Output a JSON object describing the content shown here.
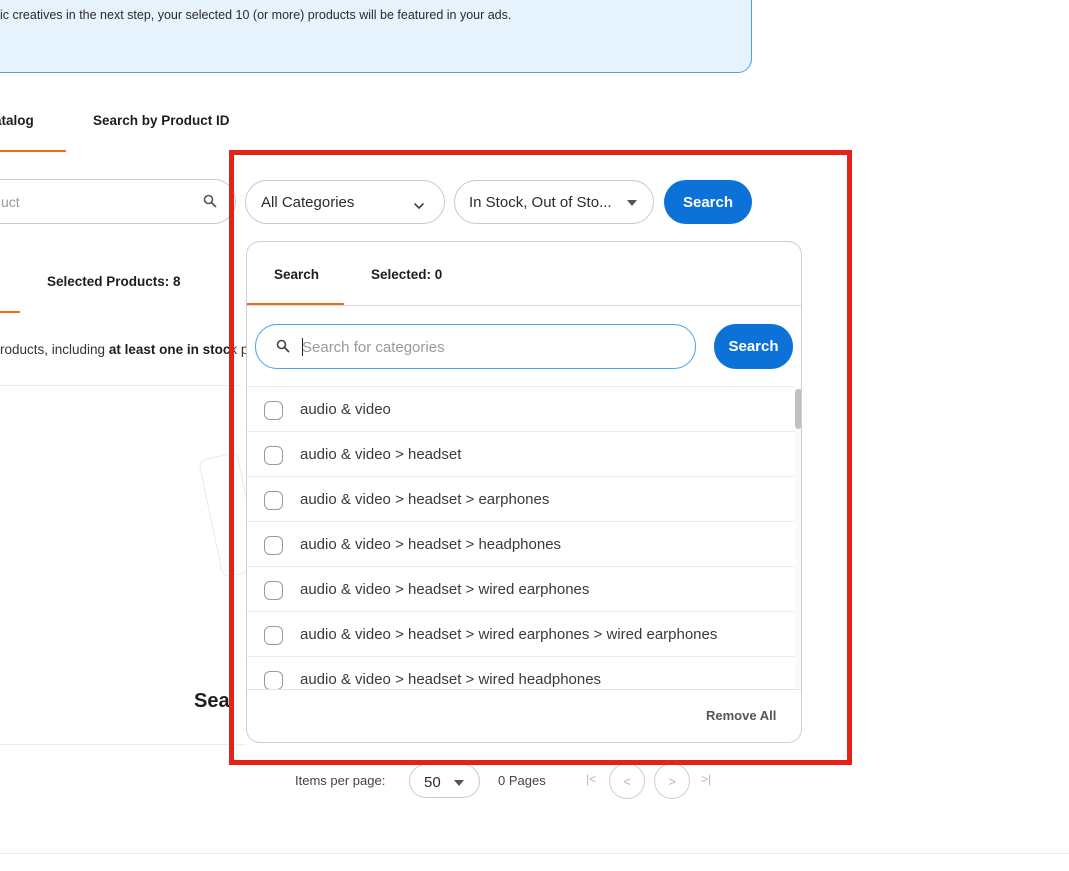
{
  "banner": {
    "text": "ic creatives in the next step, your selected 10 (or more) products will be featured in your ads."
  },
  "tabs": [
    {
      "label": "atalog"
    },
    {
      "label": "Search by Product ID"
    }
  ],
  "filters": {
    "product_search_placeholder": "uct",
    "category_value": "All Categories",
    "stock_value": "In Stock, Out of Sto...",
    "search_button": "Search"
  },
  "background": {
    "selected_products": "Selected Products: 8",
    "notice_prefix": "roducts, including ",
    "notice_bold": "at least one in stoc",
    "notice_suffix": "k p",
    "heading": "Sea"
  },
  "pagination": {
    "label": "Items per page:",
    "per_page": "50",
    "pages": "0 Pages",
    "first_glyph": "|<",
    "prev_glyph": "<",
    "next_glyph": ">",
    "last_glyph": ">|"
  },
  "panel": {
    "tab_search": "Search",
    "tab_selected": "Selected: 0",
    "search_placeholder": "Search for categories",
    "search_button": "Search",
    "items": [
      {
        "label": "audio & video"
      },
      {
        "label": "audio & video > headset"
      },
      {
        "label": "audio & video > headset > earphones"
      },
      {
        "label": "audio & video > headset > headphones"
      },
      {
        "label": "audio & video > headset > wired earphones"
      },
      {
        "label": "audio & video > headset > wired earphones > wired earphones"
      },
      {
        "label": "audio & video > headset > wired headphones"
      }
    ],
    "remove_all": "Remove All"
  },
  "colors": {
    "accent": "#0d72d8",
    "tab_underline": "#f26b1d",
    "highlight": "#e32219",
    "banner_bg": "#e6f3fd"
  },
  "icons": {
    "search": "search-icon",
    "dropdown": "chevron-down-icon",
    "caret": "caret-down-icon"
  }
}
